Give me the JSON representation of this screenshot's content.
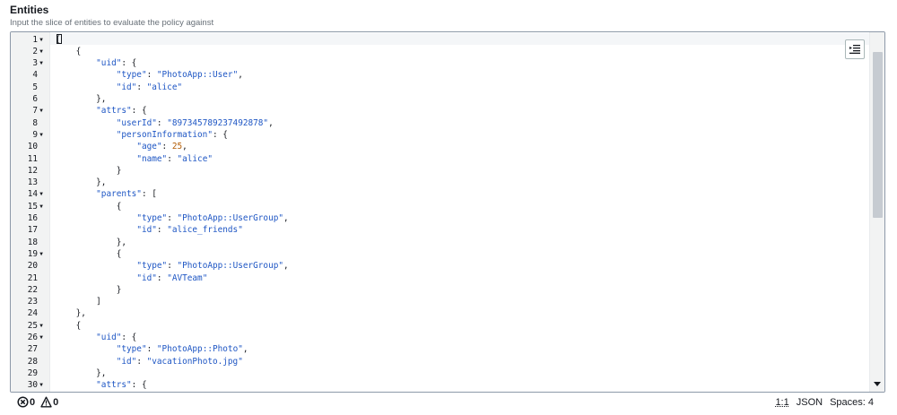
{
  "header": {
    "title": "Entities",
    "description": "Input the slice of entities to evaluate the policy against"
  },
  "editor": {
    "lines": [
      {
        "n": "1",
        "fold": true,
        "tokens": [
          [
            "punc",
            "["
          ]
        ]
      },
      {
        "n": "2",
        "fold": true,
        "tokens": [
          [
            "punc",
            "    {"
          ]
        ]
      },
      {
        "n": "3",
        "fold": true,
        "tokens": [
          [
            "punc",
            "        "
          ],
          [
            "key",
            "\"uid\""
          ],
          [
            "punc",
            ": {"
          ]
        ]
      },
      {
        "n": "4",
        "fold": false,
        "tokens": [
          [
            "punc",
            "            "
          ],
          [
            "key",
            "\"type\""
          ],
          [
            "punc",
            ": "
          ],
          [
            "str",
            "\"PhotoApp::User\""
          ],
          [
            "punc",
            ","
          ]
        ]
      },
      {
        "n": "5",
        "fold": false,
        "tokens": [
          [
            "punc",
            "            "
          ],
          [
            "key",
            "\"id\""
          ],
          [
            "punc",
            ": "
          ],
          [
            "str",
            "\"alice\""
          ]
        ]
      },
      {
        "n": "6",
        "fold": false,
        "tokens": [
          [
            "punc",
            "        },"
          ]
        ]
      },
      {
        "n": "7",
        "fold": true,
        "tokens": [
          [
            "punc",
            "        "
          ],
          [
            "key",
            "\"attrs\""
          ],
          [
            "punc",
            ": {"
          ]
        ]
      },
      {
        "n": "8",
        "fold": false,
        "tokens": [
          [
            "punc",
            "            "
          ],
          [
            "key",
            "\"userId\""
          ],
          [
            "punc",
            ": "
          ],
          [
            "str",
            "\"897345789237492878\""
          ],
          [
            "punc",
            ","
          ]
        ]
      },
      {
        "n": "9",
        "fold": true,
        "tokens": [
          [
            "punc",
            "            "
          ],
          [
            "key",
            "\"personInformation\""
          ],
          [
            "punc",
            ": {"
          ]
        ]
      },
      {
        "n": "10",
        "fold": false,
        "tokens": [
          [
            "punc",
            "                "
          ],
          [
            "key",
            "\"age\""
          ],
          [
            "punc",
            ": "
          ],
          [
            "num",
            "25"
          ],
          [
            "punc",
            ","
          ]
        ]
      },
      {
        "n": "11",
        "fold": false,
        "tokens": [
          [
            "punc",
            "                "
          ],
          [
            "key",
            "\"name\""
          ],
          [
            "punc",
            ": "
          ],
          [
            "str",
            "\"alice\""
          ]
        ]
      },
      {
        "n": "12",
        "fold": false,
        "tokens": [
          [
            "punc",
            "            }"
          ]
        ]
      },
      {
        "n": "13",
        "fold": false,
        "tokens": [
          [
            "punc",
            "        },"
          ]
        ]
      },
      {
        "n": "14",
        "fold": true,
        "tokens": [
          [
            "punc",
            "        "
          ],
          [
            "key",
            "\"parents\""
          ],
          [
            "punc",
            ": ["
          ]
        ]
      },
      {
        "n": "15",
        "fold": true,
        "tokens": [
          [
            "punc",
            "            {"
          ]
        ]
      },
      {
        "n": "16",
        "fold": false,
        "tokens": [
          [
            "punc",
            "                "
          ],
          [
            "key",
            "\"type\""
          ],
          [
            "punc",
            ": "
          ],
          [
            "str",
            "\"PhotoApp::UserGroup\""
          ],
          [
            "punc",
            ","
          ]
        ]
      },
      {
        "n": "17",
        "fold": false,
        "tokens": [
          [
            "punc",
            "                "
          ],
          [
            "key",
            "\"id\""
          ],
          [
            "punc",
            ": "
          ],
          [
            "str",
            "\"alice_friends\""
          ]
        ]
      },
      {
        "n": "18",
        "fold": false,
        "tokens": [
          [
            "punc",
            "            },"
          ]
        ]
      },
      {
        "n": "19",
        "fold": true,
        "tokens": [
          [
            "punc",
            "            {"
          ]
        ]
      },
      {
        "n": "20",
        "fold": false,
        "tokens": [
          [
            "punc",
            "                "
          ],
          [
            "key",
            "\"type\""
          ],
          [
            "punc",
            ": "
          ],
          [
            "str",
            "\"PhotoApp::UserGroup\""
          ],
          [
            "punc",
            ","
          ]
        ]
      },
      {
        "n": "21",
        "fold": false,
        "tokens": [
          [
            "punc",
            "                "
          ],
          [
            "key",
            "\"id\""
          ],
          [
            "punc",
            ": "
          ],
          [
            "str",
            "\"AVTeam\""
          ]
        ]
      },
      {
        "n": "22",
        "fold": false,
        "tokens": [
          [
            "punc",
            "            }"
          ]
        ]
      },
      {
        "n": "23",
        "fold": false,
        "tokens": [
          [
            "punc",
            "        ]"
          ]
        ]
      },
      {
        "n": "24",
        "fold": false,
        "tokens": [
          [
            "punc",
            "    },"
          ]
        ]
      },
      {
        "n": "25",
        "fold": true,
        "tokens": [
          [
            "punc",
            "    {"
          ]
        ]
      },
      {
        "n": "26",
        "fold": true,
        "tokens": [
          [
            "punc",
            "        "
          ],
          [
            "key",
            "\"uid\""
          ],
          [
            "punc",
            ": {"
          ]
        ]
      },
      {
        "n": "27",
        "fold": false,
        "tokens": [
          [
            "punc",
            "            "
          ],
          [
            "key",
            "\"type\""
          ],
          [
            "punc",
            ": "
          ],
          [
            "str",
            "\"PhotoApp::Photo\""
          ],
          [
            "punc",
            ","
          ]
        ]
      },
      {
        "n": "28",
        "fold": false,
        "tokens": [
          [
            "punc",
            "            "
          ],
          [
            "key",
            "\"id\""
          ],
          [
            "punc",
            ": "
          ],
          [
            "str",
            "\"vacationPhoto.jpg\""
          ]
        ]
      },
      {
        "n": "29",
        "fold": false,
        "tokens": [
          [
            "punc",
            "        },"
          ]
        ]
      },
      {
        "n": "30",
        "fold": true,
        "tokens": [
          [
            "punc",
            "        "
          ],
          [
            "key",
            "\"attrs\""
          ],
          [
            "punc",
            ": {"
          ]
        ]
      }
    ],
    "settings_icon": "list-indent-icon"
  },
  "status": {
    "errors": "0",
    "warnings": "0",
    "error_icon": "error-circle-icon",
    "warning_icon": "warning-triangle-icon",
    "cursor_position": "1:1",
    "language": "JSON",
    "indentation": "Spaces: 4"
  },
  "colors": {
    "key": "#1e56c4",
    "string": "#1e56c4",
    "number": "#b35a00",
    "gutter_bg": "#f2f3f3",
    "border": "#8d99a8"
  }
}
